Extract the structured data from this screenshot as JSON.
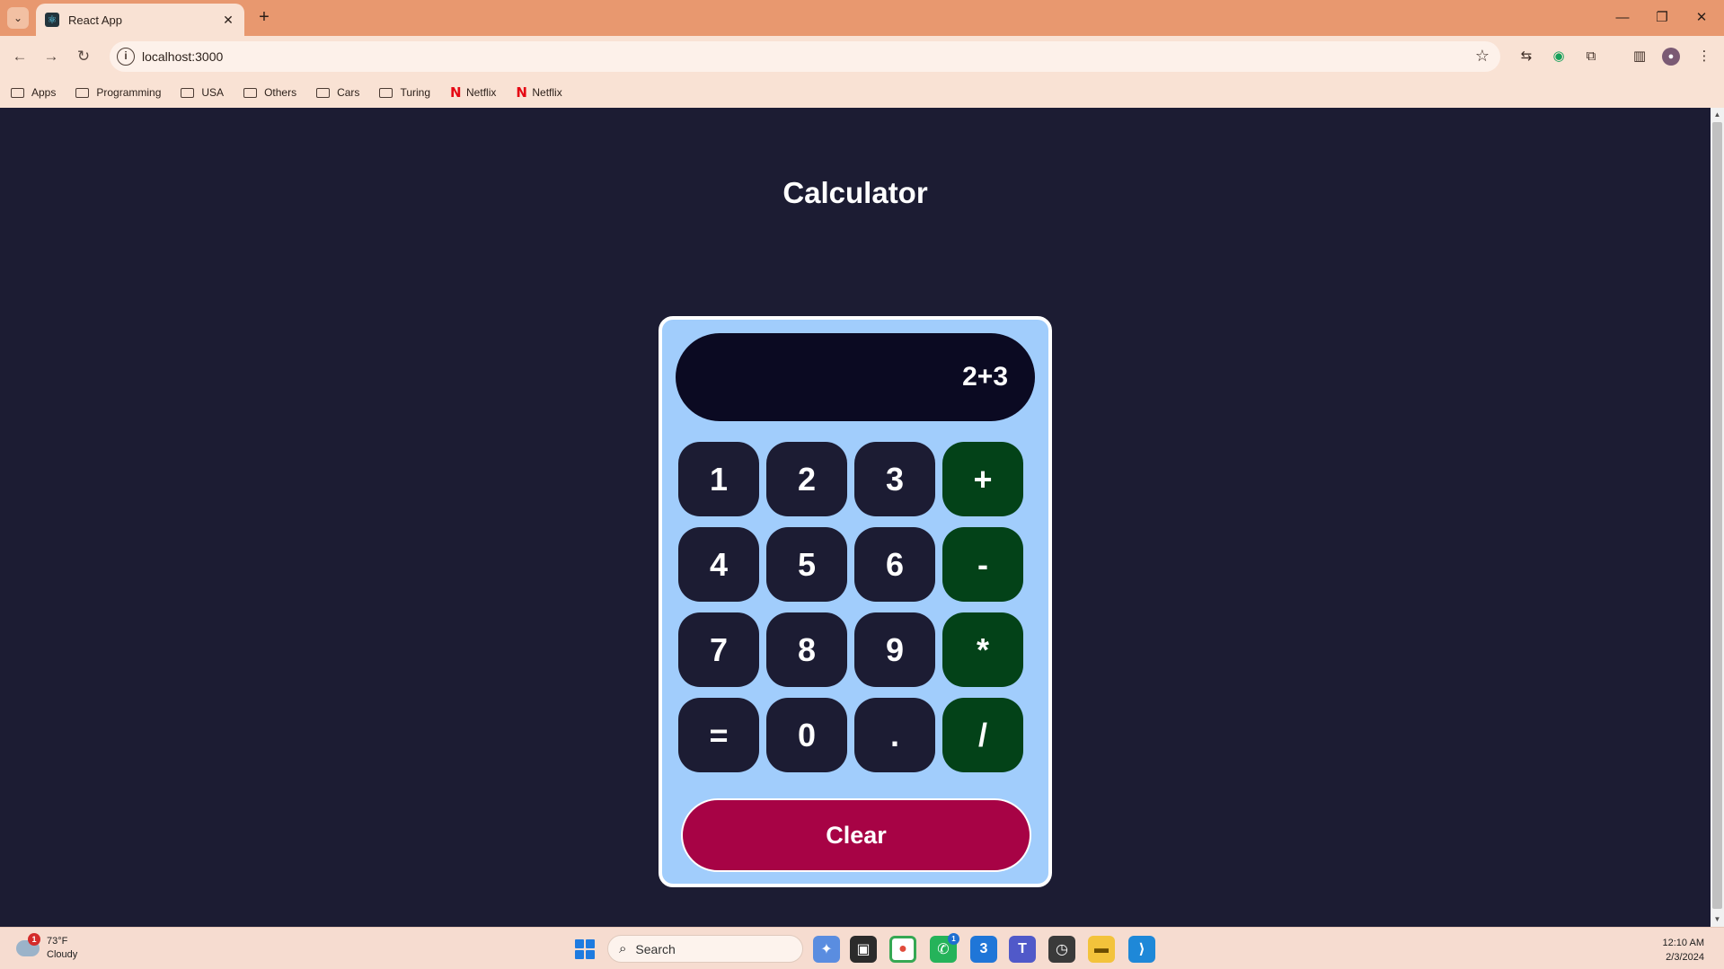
{
  "browser": {
    "tab_title": "React App",
    "url": "localhost:3000",
    "bookmarks": [
      {
        "label": "Apps",
        "icon": "folder-icon"
      },
      {
        "label": "Programming",
        "icon": "folder-icon"
      },
      {
        "label": "USA",
        "icon": "folder-icon"
      },
      {
        "label": "Others",
        "icon": "folder-icon"
      },
      {
        "label": "Cars",
        "icon": "folder-icon"
      },
      {
        "label": "Turing",
        "icon": "folder-icon"
      },
      {
        "label": "Netflix",
        "icon": "netflix-icon"
      },
      {
        "label": "Netflix",
        "icon": "netflix-icon"
      }
    ]
  },
  "page": {
    "title": "Calculator"
  },
  "calculator": {
    "display": "2+3",
    "keys": [
      {
        "label": "1",
        "type": "digit"
      },
      {
        "label": "2",
        "type": "digit"
      },
      {
        "label": "3",
        "type": "digit"
      },
      {
        "label": "+",
        "type": "operator"
      },
      {
        "label": "4",
        "type": "digit"
      },
      {
        "label": "5",
        "type": "digit"
      },
      {
        "label": "6",
        "type": "digit"
      },
      {
        "label": "-",
        "type": "operator"
      },
      {
        "label": "7",
        "type": "digit"
      },
      {
        "label": "8",
        "type": "digit"
      },
      {
        "label": "9",
        "type": "digit"
      },
      {
        "label": "*",
        "type": "operator"
      },
      {
        "label": "=",
        "type": "equals"
      },
      {
        "label": "0",
        "type": "digit"
      },
      {
        "label": ".",
        "type": "decimal"
      },
      {
        "label": "/",
        "type": "operator"
      }
    ],
    "clear_label": "Clear"
  },
  "taskbar": {
    "weather_temp": "73°F",
    "weather_desc": "Cloudy",
    "weather_badge": "1",
    "search_label": "Search",
    "time": "12:10 AM",
    "date": "2/3/2024"
  },
  "colors": {
    "page_bg": "#1c1c33",
    "calc_bg": "#a1cdfc",
    "display_bg": "#0b0a22",
    "digit_key": "#1c1c33",
    "operator_key": "#034218",
    "clear_button": "#a70345",
    "browser_frame": "#e8986f"
  }
}
